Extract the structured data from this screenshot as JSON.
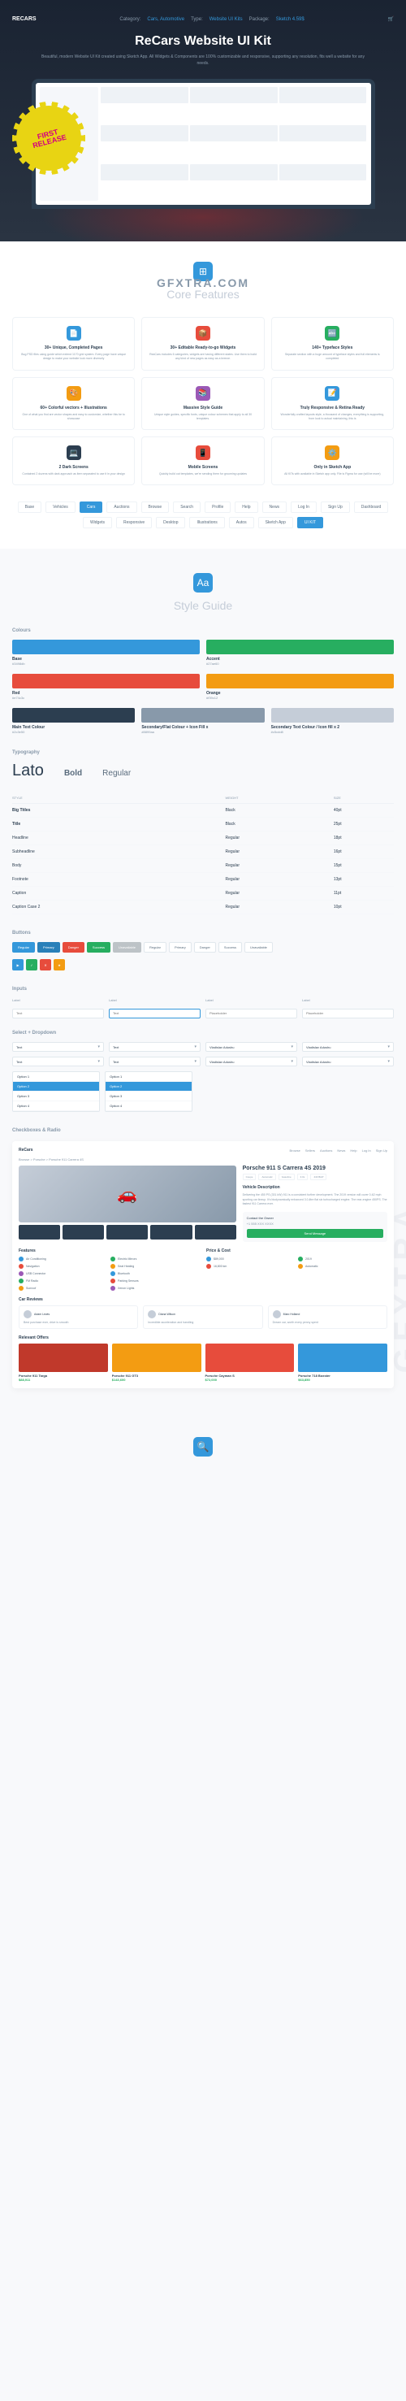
{
  "nav": {
    "logo": "RECARS",
    "links": [
      "Category:",
      "Cars, Automotive",
      "Type:",
      "Website UI Kits",
      "Package:",
      "Sketch 4.59$"
    ]
  },
  "hero": {
    "title": "ReCars Website UI Kit",
    "subtitle": "Beautiful, modern Website UI Kit created using Sketch App. All Widgets & Components are 100% customizable and responsive, supporting any resolution, fits well a website for any needs."
  },
  "badge": {
    "line1": "FIRST",
    "line2": "RELEASE"
  },
  "watermark": "GFXTRA.COM",
  "side_watermark": "GFXTRA",
  "coreFeatures": {
    "title": "Core Features",
    "items": [
      {
        "icon": "📄",
        "color": "#3498db",
        "title": "30+ Unique, Completed Pages",
        "desc": "Bug PSD files using guide which extend 1170 grid system. Every page have unique design to make your website look more diversely"
      },
      {
        "icon": "📦",
        "color": "#e74c3c",
        "title": "30+ Editable Ready-to-go Widgets",
        "desc": "ReaCars includes 6 categories, widgets are having different states. Use them to build any kind of new pages as easy as a breeze."
      },
      {
        "icon": "🔤",
        "color": "#27ae60",
        "title": "140+ Typeface Styles",
        "desc": "Separate section with a huge amount of typeface styles and full elements is completed"
      },
      {
        "icon": "🎨",
        "color": "#f39c12",
        "title": "60+ Colorful vectors + Illustrations",
        "desc": "One of what you find are vector shapes and easy to customize, whether this be to showcase"
      },
      {
        "icon": "📚",
        "color": "#9b59b6",
        "title": "Massive Style Guide",
        "desc": "Unique style guides, specific fonts, unique colour schemes that apply to all 30 templates."
      },
      {
        "icon": "📝",
        "color": "#3498db",
        "title": "Truly Responsive & Retina Ready",
        "desc": "Wonderfully crafted layouts style, a thousand of changes, everything is supporting, from look to actual maintaining, this is"
      },
      {
        "icon": "💻",
        "color": "#2c3e50",
        "title": "2 Dark Screens",
        "desc": "Contained 2 dozens with dark approach as item separated to use it in your design"
      },
      {
        "icon": "📱",
        "color": "#e74c3c",
        "title": "Mobile Screens",
        "desc": "Quickly build out templates, we're sending them for grooming updates"
      },
      {
        "icon": "⚙️",
        "color": "#f39c12",
        "title": "Only in Sketch App",
        "desc": "All KITs with available in Sketch app only. File is Figma for use (will be more)"
      }
    ],
    "tags": [
      "Base",
      "Vehicles",
      "Cars",
      "Auctions",
      "Browse",
      "Search",
      "Profile",
      "Help",
      "News",
      "Log In",
      "Sign Up",
      "Dashboard",
      "Widgets",
      "Responsive",
      "Desktop",
      "Illustrations",
      "Autos",
      "Sketch App",
      "UI KIT"
    ]
  },
  "styleGuide": {
    "title": "Style Guide",
    "colors": {
      "label": "Colours",
      "row1": [
        {
          "name": "Base",
          "hex": "#3498db",
          "bar": "#3498db"
        },
        {
          "name": "Accent",
          "hex": "#27ae60",
          "bar": "#27ae60"
        }
      ],
      "row2": [
        {
          "name": "Red",
          "hex": "#e74c3c",
          "bar": "#e74c3c"
        },
        {
          "name": "Orange",
          "hex": "#f39c12",
          "bar": "#f39c12"
        }
      ],
      "row3": [
        {
          "name": "Main Text Colour",
          "hex": "#2c3e50",
          "bar": "#2c3e50"
        },
        {
          "name": "Secondary/Flat Colour + Icon Fill x",
          "hex": "#8899aa",
          "bar": "#8899aa"
        },
        {
          "name": "Secondary Text Colour / Icon fill x 2",
          "hex": "#c5cdd8",
          "bar": "#c5cdd8"
        }
      ]
    },
    "typography": {
      "label": "Typography",
      "font": "Lato",
      "weights": [
        "Bold",
        "Regular"
      ],
      "table": {
        "headers": [
          "STYLE",
          "WEIGHT",
          "SIZE"
        ],
        "rows": [
          [
            "Big Titles",
            "Black",
            "40pt"
          ],
          [
            "Title",
            "Black",
            "25pt"
          ],
          [
            "Headline",
            "Regular",
            "18pt"
          ],
          [
            "Subheadline",
            "Regular",
            "16pt"
          ],
          [
            "Body",
            "Regular",
            "15pt"
          ],
          [
            "Footnote",
            "Regular",
            "13pt"
          ],
          [
            "Caption",
            "Regular",
            "11pt"
          ],
          [
            "Caption Case 2",
            "Regular",
            "10pt"
          ]
        ]
      }
    },
    "buttons": {
      "label": "Buttons",
      "row1": [
        "Regular",
        "Primary",
        "Danger",
        "Success",
        "Unavailable",
        "Regular",
        "Primary",
        "Danger",
        "Success",
        "Unavailable"
      ],
      "colors1": [
        "#3498db",
        "#2980b9",
        "#e74c3c",
        "#27ae60",
        "#bdc3c7",
        "#fff",
        "#fff",
        "#fff",
        "#fff",
        "#fff"
      ]
    },
    "inputs": {
      "label": "Inputs",
      "items": [
        {
          "lbl": "Label",
          "ph": "Text"
        },
        {
          "lbl": "Label",
          "ph": "Text",
          "focus": true
        },
        {
          "lbl": "Label",
          "ph": "Placeholder"
        },
        {
          "lbl": "Label",
          "ph": "Placeholder"
        }
      ]
    },
    "selects": {
      "label": "Select + Dropdown",
      "items": [
        "Text",
        "Text",
        "Vladislav Adushu",
        "Vladislav Adushu"
      ],
      "ddOptions": [
        "Option 1",
        "Option 2",
        "Option 3",
        "Option 4"
      ]
    },
    "checkboxes": {
      "label": "Checkboxes & Radio"
    }
  },
  "productPage": {
    "logo": "ReCars",
    "nav": [
      "Browse",
      "Sellers",
      "Auctions",
      "News",
      "Help",
      "Log In",
      "Sign Up"
    ],
    "crumbs": "Browse > Porsche > Porsche 911 Carrera 4S",
    "title": "Porsche 911 S Carrera 4S 2019",
    "chips": [
      "Coupe",
      "Automatic",
      "Gasoline",
      "3.0L",
      "443 BHP"
    ],
    "descTitle": "Vehicle Description",
    "desc": "Delivering the 450 PS (331 kW) 911 is a consistent further development. The 2019 version will cover 0-62 mph sporting car lineup. It's biodynamically enhanced 3.0-litre flat six turbocharged engine. The rear-engine 450PS. The fastest 911 Carrera ever.",
    "contact": {
      "name": "Contact the Owner",
      "phone": "+1 555 XXX XXXX",
      "btn": "Send Message"
    },
    "features": {
      "title": "Features",
      "items": [
        "Air Conditioning",
        "Electric Mirrors",
        "Navigation",
        "Seat Heating",
        "USB Connector",
        "Bluetooth",
        "FM Radio",
        "Parking Sensors",
        "Sunroof",
        "Xenon Lights"
      ]
    },
    "toc": {
      "title": "Price & Cost",
      "items": [
        "$89,000",
        "2019",
        "16,800 km",
        "Automatic"
      ]
    },
    "reviews": {
      "title": "Car Reviews",
      "items": [
        {
          "name": "Adam Lewis",
          "text": "Best purchase ever, drive is smooth"
        },
        {
          "name": "Diana Wilson",
          "text": "Incredible acceleration and handling"
        },
        {
          "name": "Marc Holland",
          "text": "Dream car, worth every penny spent"
        }
      ]
    },
    "offers": {
      "title": "Relevant Offers",
      "items": [
        {
          "title": "Porsche 911 Targa",
          "price": "$88,911",
          "color": "#c0392b"
        },
        {
          "title": "Porsche 911 GT3",
          "price": "$143,600",
          "color": "#f39c12"
        },
        {
          "title": "Porsche Cayman S",
          "price": "$72,000",
          "color": "#e74c3c"
        },
        {
          "title": "Porsche 718 Boxster",
          "price": "$63,850",
          "color": "#3498db"
        }
      ]
    }
  }
}
